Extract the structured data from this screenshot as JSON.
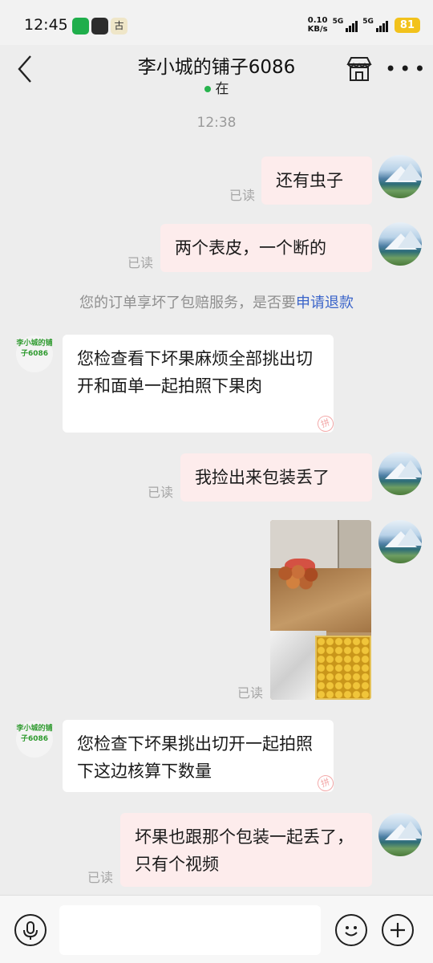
{
  "status_bar": {
    "time": "12:45",
    "app_badge_label": "古",
    "net_speed": "0.10",
    "net_unit": "KB/s",
    "sim1_label": "5G",
    "sim2_label": "5G",
    "battery": "81"
  },
  "header": {
    "title": "李小城的铺子6086",
    "status": "在"
  },
  "chat": {
    "timestamp": "12:38",
    "read_label": "已读",
    "shop_avatar_text": "李小城的铺子6086",
    "messages": [
      {
        "sender": "me",
        "text": "还有虫子",
        "read": "已读"
      },
      {
        "sender": "me",
        "text": "两个表皮，一个断的",
        "read": "已读"
      },
      {
        "sender": "them",
        "text": "您检查看下坏果麻烦全部挑出切开和面单一起拍照下果肉"
      },
      {
        "sender": "me",
        "text": "我捡出来包装丢了",
        "read": "已读"
      },
      {
        "sender": "me",
        "type": "image",
        "read": "已读"
      },
      {
        "sender": "them",
        "text": "您检查下坏果挑出切开一起拍照下这边核算下数量"
      },
      {
        "sender": "me",
        "text": "坏果也跟那个包装一起丢了，只有个视频",
        "read": "已读"
      }
    ],
    "system_notice": {
      "text": "您的订单享坏了包赔服务，是否要",
      "link": "申请退款"
    }
  },
  "colors": {
    "my_bubble": "#fdecec",
    "their_bubble": "#ffffff",
    "background": "#ededed",
    "link": "#3a64c9",
    "online_dot": "#27b34d"
  },
  "icons": [
    "back-icon",
    "store-icon",
    "more-icon",
    "voice-icon",
    "emoji-icon",
    "plus-icon"
  ]
}
